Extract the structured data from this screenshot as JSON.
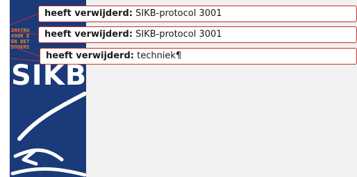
{
  "logo": {
    "lines": [
      "INSTRU",
      "VOOR E",
      "EN BET",
      "BODEMI"
    ],
    "word": "SIKB"
  },
  "balloons": [
    {
      "label": "heeft verwijderd:",
      "text": "SIKB-protocol 3001"
    },
    {
      "label": "heeft verwijderd:",
      "text": "SIKB-protocol 3001"
    },
    {
      "label": "heeft verwijderd:",
      "text": "techniek¶"
    }
  ],
  "colors": {
    "revision_red": "#c0302f",
    "logo_blue": "#1a3a7a",
    "logo_orange": "#f08a2a"
  }
}
